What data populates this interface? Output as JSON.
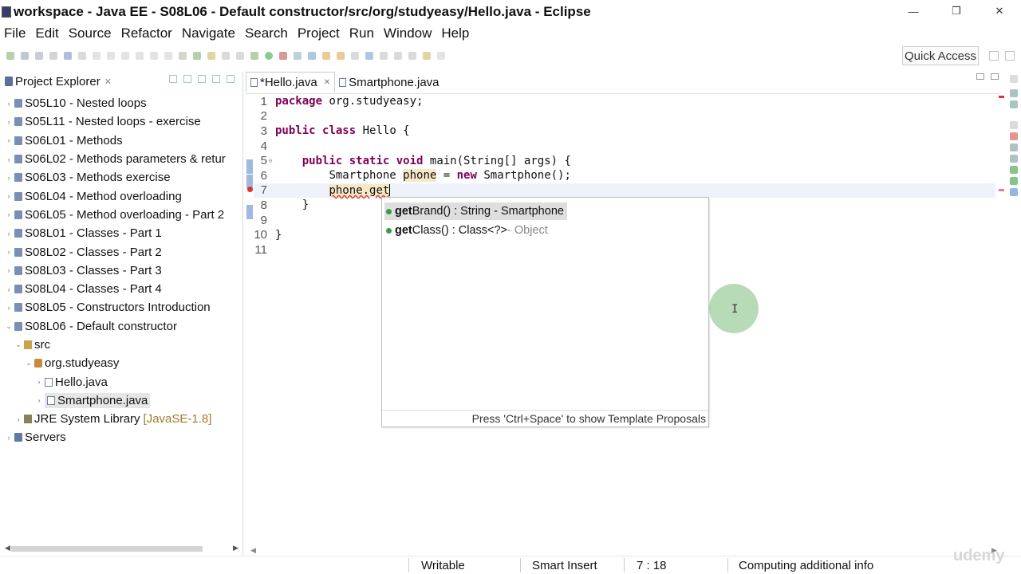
{
  "window": {
    "title": "workspace - Java EE - S08L06 - Default constructor/src/org/studyeasy/Hello.java - Eclipse",
    "controls": [
      "—",
      "❐",
      "✕"
    ]
  },
  "menu": [
    "File",
    "Edit",
    "Source",
    "Refactor",
    "Navigate",
    "Search",
    "Project",
    "Run",
    "Window",
    "Help"
  ],
  "toolbar": {
    "quick_access_label": "Quick Access"
  },
  "explorer": {
    "tab_label": "Project Explorer",
    "tab_close": "✕",
    "items": [
      {
        "label": "S05L10 - Nested loops",
        "arrow": "›",
        "icon": "project-icon"
      },
      {
        "label": "S05L11 - Nested loops - exercise",
        "arrow": "›",
        "icon": "project-icon"
      },
      {
        "label": "S06L01 - Methods",
        "arrow": "›",
        "icon": "project-icon"
      },
      {
        "label": "S06L02 - Methods parameters & retur",
        "arrow": "›",
        "icon": "project-icon"
      },
      {
        "label": "S06L03 - Methods exercise",
        "arrow": "›",
        "icon": "project-icon"
      },
      {
        "label": "S06L04 - Method overloading",
        "arrow": "›",
        "icon": "project-icon"
      },
      {
        "label": "S06L05 - Method overloading - Part 2",
        "arrow": "›",
        "icon": "project-icon"
      },
      {
        "label": "S08L01 - Classes - Part 1",
        "arrow": "›",
        "icon": "project-icon"
      },
      {
        "label": "S08L02 - Classes - Part 2",
        "arrow": "›",
        "icon": "project-icon"
      },
      {
        "label": "S08L03 - Classes - Part 3",
        "arrow": "›",
        "icon": "project-icon"
      },
      {
        "label": "S08L04 - Classes - Part 4",
        "arrow": "›",
        "icon": "project-icon"
      },
      {
        "label": "S08L05 - Constructors Introduction",
        "arrow": "›",
        "icon": "project-icon"
      },
      {
        "label": "S08L06 - Default constructor",
        "arrow": "⌄",
        "icon": "project-icon"
      },
      {
        "label": "src",
        "arrow": "⌄",
        "icon": "source-folder-icon"
      },
      {
        "label": "org.studyeasy",
        "arrow": "⌄",
        "icon": "package-icon"
      },
      {
        "label": "Hello.java",
        "arrow": "›",
        "icon": "java-file-icon"
      },
      {
        "label": "Smartphone.java",
        "arrow": "›",
        "icon": "java-file-icon"
      },
      {
        "label": "JRE System Library",
        "tag": "[JavaSE-1.8]",
        "arrow": "›",
        "icon": "library-icon"
      },
      {
        "label": "Servers",
        "arrow": "›",
        "icon": "server-icon"
      }
    ]
  },
  "editor": {
    "tabs": [
      {
        "label": "*Hello.java",
        "close": "✕"
      },
      {
        "label": "Smartphone.java"
      }
    ],
    "line_numbers": [
      "1",
      "2",
      "3",
      "4",
      "5",
      "6",
      "7",
      "8",
      "9",
      "10",
      "11"
    ],
    "code": {
      "l1_kw": "package",
      "l1_rest": " org.studyeasy;",
      "l3_kw1": "public",
      "l3_kw2": "class",
      "l3_rest": " Hello {",
      "l5_indent": "    ",
      "l5_kw1": "public",
      "l5_kw2": "static",
      "l5_kw3": "void",
      "l5_rest": " main(String[] args) {",
      "l6_indent": "        ",
      "l6_type": "Smartphone ",
      "l6_var": "phone",
      "l6_eq": " = ",
      "l6_kw": "new",
      "l6_rest": " Smartphone();",
      "l7_indent": "        ",
      "l7_var": "phone",
      "l7_rest": ".get",
      "l8_text": "    }",
      "l10_text": "}"
    }
  },
  "completion": {
    "items": [
      {
        "bold": "get",
        "rest": "Brand() : String - Smartphone",
        "muted": ""
      },
      {
        "bold": "get",
        "rest": "Class() : Class<?>",
        "muted": " - Object"
      }
    ],
    "footer": "Press 'Ctrl+Space' to show Template Proposals"
  },
  "status": {
    "writable": "Writable",
    "insert_mode": "Smart Insert",
    "position": "7 : 18",
    "progress": "Computing additional info"
  },
  "colors": {
    "keyword": "#7f0055",
    "current_line": "#eef3fb",
    "occurrence_highlight": "#f6e8c6",
    "method_dot": "#3c9a47",
    "error": "#d33333"
  }
}
